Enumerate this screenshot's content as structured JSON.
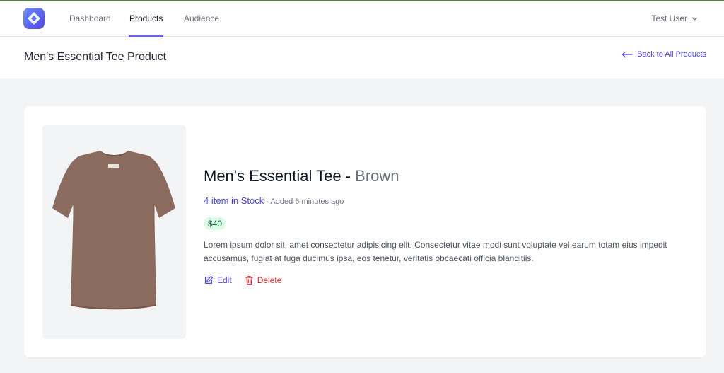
{
  "nav": {
    "links": [
      {
        "label": "Dashboard",
        "active": false
      },
      {
        "label": "Products",
        "active": true
      },
      {
        "label": "Audience",
        "active": false
      }
    ],
    "user": {
      "name": "Test User",
      "icon": "chevron-down-icon"
    }
  },
  "header": {
    "title": "Men's Essential Tee Product",
    "back_label": "Back to All Products"
  },
  "product": {
    "name": "Men's Essential Tee -",
    "variant": "Brown",
    "stock_text": "4 item in Stock",
    "added_text": " - Added 6 minutes ago",
    "price": "$40",
    "description": "Lorem ipsum dolor sit, amet consectetur adipisicing elit. Consectetur vitae modi sunt voluptate vel earum totam eius impedit accusamus, fugiat at fuga ducimus ipsa, eos tenetur, veritatis obcaecati officia blanditiis.",
    "edit_label": "Edit",
    "delete_label": "Delete"
  },
  "colors": {
    "accent": "#4f46e5",
    "danger": "#dc2626",
    "price_bg": "#dcfce7",
    "price_text": "#166534",
    "shirt": "#8a6b5e"
  }
}
